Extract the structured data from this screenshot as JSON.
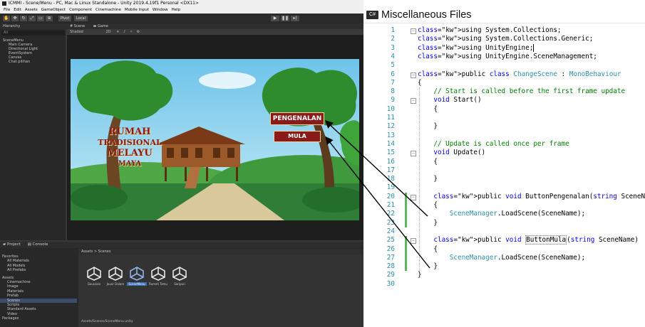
{
  "unity": {
    "window_title": "ICMMI - Scene/Menu - PC, Mac & Linux Standalone - Unity 2019.4.19f1 Personal <DX11>",
    "menu": [
      "File",
      "Edit",
      "Assets",
      "GameObject",
      "Component",
      "Cinemachine",
      "Mobile Input",
      "Window",
      "Help"
    ],
    "toolbar": {
      "pivot": "Pivot",
      "local": "Local"
    },
    "hierarchy": {
      "tab": "Hierarchy",
      "search_placeholder": "All",
      "items": [
        "SceneMenu",
        "Main Camera",
        "Directional Light",
        "EventSystem",
        "Canvas",
        "Chat pilihan"
      ]
    },
    "scene": {
      "tab_scene": "Scene",
      "tab_game": "Game",
      "shading_mode": "Shaded",
      "mode_2d": "2D"
    },
    "game": {
      "title_lines": [
        "RUMAH",
        "TRADISIONAL",
        "MELAYU",
        "MAYA"
      ],
      "btn_pengenalan": "PENGENALAN",
      "btn_mula": "MULA"
    },
    "project": {
      "tab_project": "Project",
      "tab_console": "Console",
      "favorites": [
        "Favorites",
        "All Materials",
        "All Models",
        "All Prefabs"
      ],
      "assets_tree": [
        "Assets",
        "Cinemachine",
        "Image",
        "Materials",
        "Prefab",
        "Scenes",
        "Scripts",
        "Standard Assets",
        "Video",
        "Packages"
      ],
      "breadcrumb": "Assets > Scenes",
      "scene_files": [
        "Gaussian",
        "Jouer Dalam",
        "SceneMenu",
        "Rumah Tamu",
        "Saripari"
      ],
      "status": "Assets/Scenes/SceneMenu.unity"
    }
  },
  "code_editor": {
    "file_title": "Miscellaneous Files",
    "file_icon": "C#",
    "lines": [
      {
        "n": "1",
        "text": "using System.Collections;"
      },
      {
        "n": "2",
        "text": "using System.Collections.Generic;"
      },
      {
        "n": "3",
        "text": "using UnityEngine;"
      },
      {
        "n": "4",
        "text": "using UnityEngine.SceneManagement;"
      },
      {
        "n": "5",
        "text": ""
      },
      {
        "n": "6",
        "text": "public class ChangeScene : MonoBehaviour"
      },
      {
        "n": "7",
        "text": "{"
      },
      {
        "n": "8",
        "text": "    // Start is called before the first frame update"
      },
      {
        "n": "9",
        "text": "    void Start()"
      },
      {
        "n": "10",
        "text": "    {"
      },
      {
        "n": "11",
        "text": ""
      },
      {
        "n": "12",
        "text": "    }"
      },
      {
        "n": "13",
        "text": ""
      },
      {
        "n": "14",
        "text": "    // Update is called once per frame"
      },
      {
        "n": "15",
        "text": "    void Update()"
      },
      {
        "n": "16",
        "text": "    {"
      },
      {
        "n": "17",
        "text": ""
      },
      {
        "n": "18",
        "text": "    }"
      },
      {
        "n": "19",
        "text": ""
      },
      {
        "n": "20",
        "text": "    public void ButtonPengenalan(string SceneName)"
      },
      {
        "n": "21",
        "text": "    {"
      },
      {
        "n": "22",
        "text": "        SceneManager.LoadScene(SceneName);"
      },
      {
        "n": "23",
        "text": "    }"
      },
      {
        "n": "24",
        "text": ""
      },
      {
        "n": "25",
        "text": "    public void ButtonMula(string SceneName)"
      },
      {
        "n": "26",
        "text": "    {"
      },
      {
        "n": "27",
        "text": "        SceneManager.LoadScene(SceneName);"
      },
      {
        "n": "28",
        "text": "    }"
      },
      {
        "n": "29",
        "text": "}"
      },
      {
        "n": "30",
        "text": ""
      }
    ]
  },
  "colors": {
    "keyword": "#0000ff",
    "type": "#2b91af",
    "comment": "#008000",
    "change_bar": "#5cb85c",
    "button_fill": "#8b1a1a"
  }
}
